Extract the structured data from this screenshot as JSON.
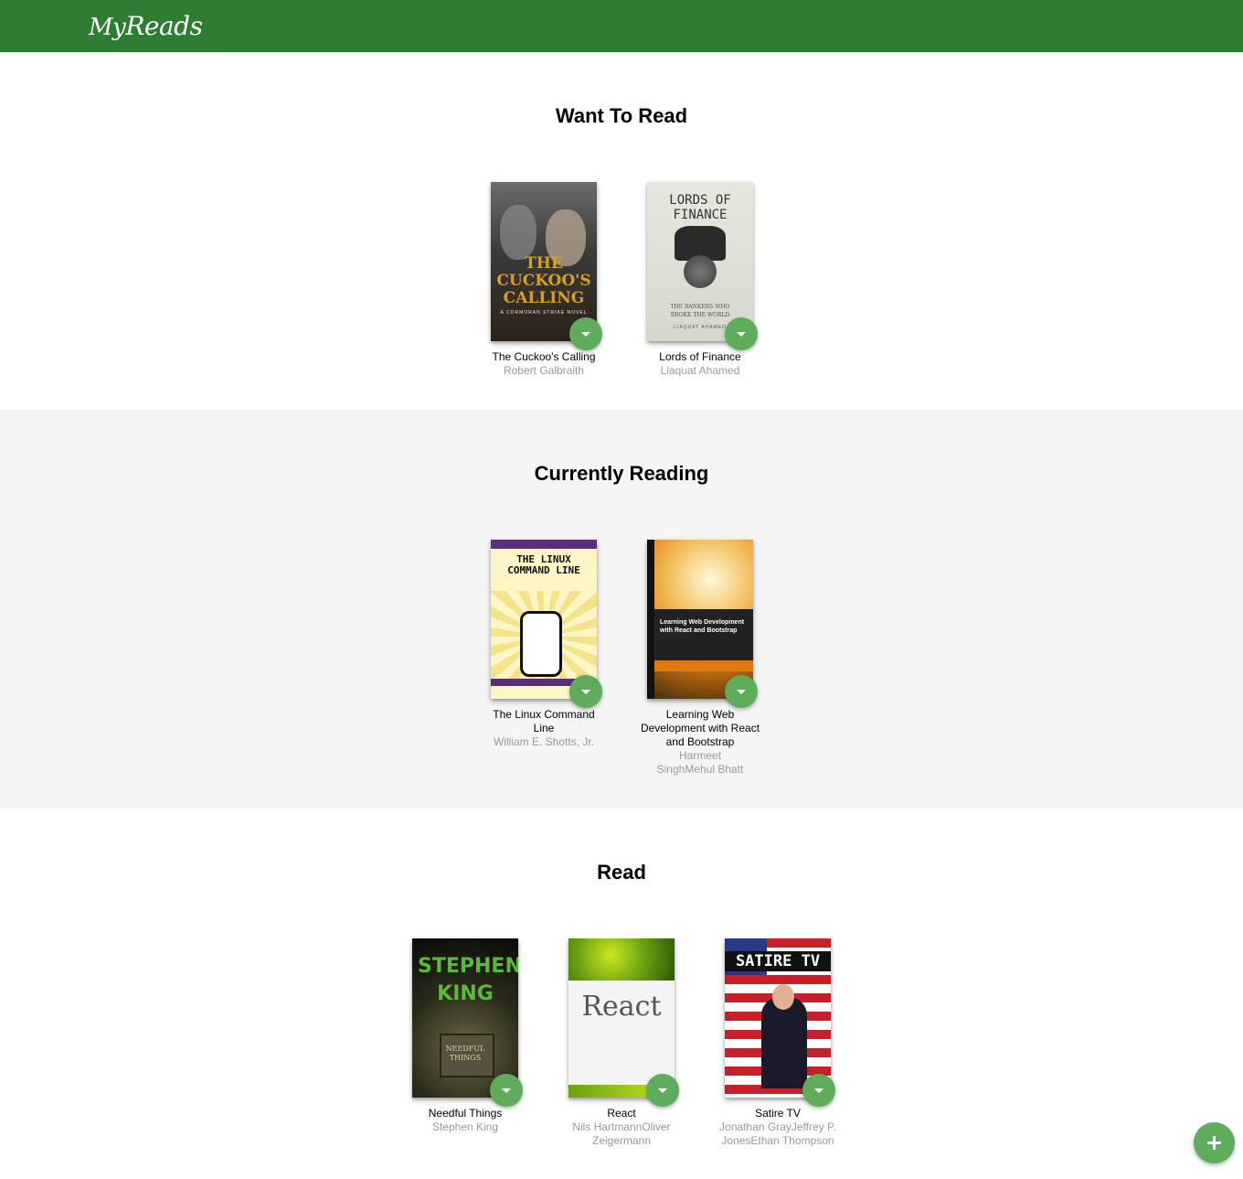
{
  "app": {
    "logo_prefix": "My",
    "logo_main": "Reads"
  },
  "shelves": {
    "want_to_read": {
      "title": "Want To Read",
      "books": [
        {
          "title": "The Cuckoo's Calling",
          "authors": "Robert Galbraith",
          "cover_title": "THE CUCKOO'S CALLING",
          "cover_tag": "A CORMORAN STRIKE NOVEL"
        },
        {
          "title": "Lords of Finance",
          "authors": "Liaquat Ahamed",
          "cover_title": "LORDS OF FINANCE",
          "cover_sub": "THE BANKERS WHO BROKE THE WORLD",
          "cover_author": "LIAQUAT AHAMED"
        }
      ]
    },
    "currently_reading": {
      "title": "Currently Reading",
      "books": [
        {
          "title": "The Linux Command Line",
          "authors": "William E. Shotts, Jr.",
          "cover_title": "THE LINUX COMMAND LINE"
        },
        {
          "title": "Learning Web Development with React and Bootstrap",
          "authors": "Harmeet SinghMehul Bhatt",
          "cover_title": "Learning Web Development with React and Bootstrap"
        }
      ]
    },
    "read": {
      "title": "Read",
      "books": [
        {
          "title": "Needful Things",
          "authors": "Stephen King",
          "cover_author": "STEPHEN KING",
          "cover_title": "NEEDFUL THINGS"
        },
        {
          "title": "React",
          "authors": "Nils HartmannOliver Zeigermann",
          "cover_title": "React"
        },
        {
          "title": "Satire TV",
          "authors": "Jonathan GrayJeffrey P. JonesEthan Thompson",
          "cover_title": "SATIRE TV"
        }
      ]
    }
  },
  "colors": {
    "header": "#2e7d32",
    "button": "#60ac5d",
    "shelf_alt_bg": "#f5f5f5"
  },
  "icons": {
    "shelf_changer": "triangle-down-icon",
    "add": "plus-icon"
  }
}
